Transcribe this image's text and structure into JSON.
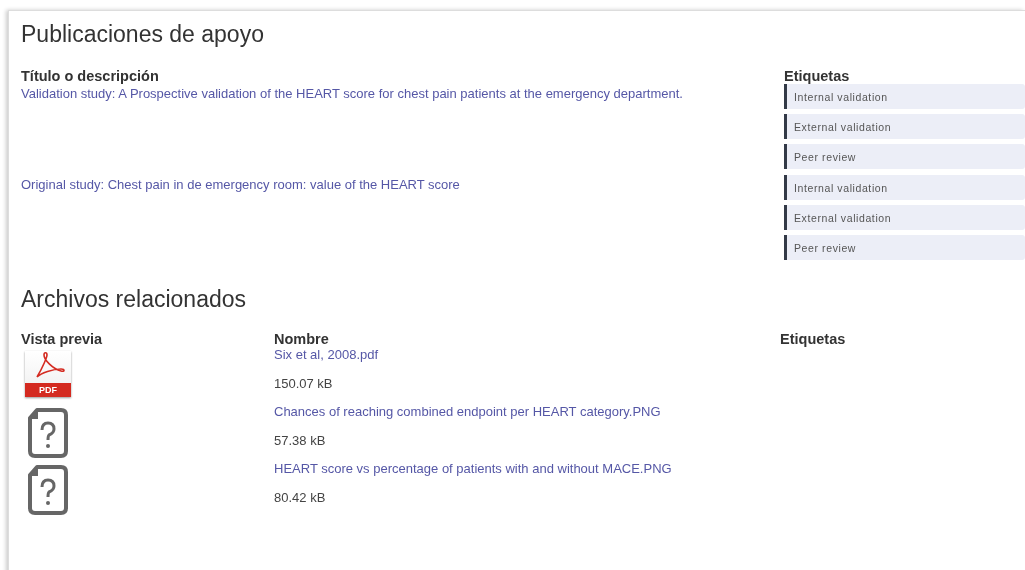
{
  "publications": {
    "title": "Publicaciones de apoyo",
    "columns": [
      "Título o descripción",
      "Etiquetas"
    ],
    "rows": [
      {
        "title": "Validation study: A Prospective validation of the HEART score for chest pain patients at the emergency department.",
        "tags": [
          "Internal validation",
          "External validation",
          "Peer review"
        ]
      },
      {
        "title": "Original study: Chest pain in de emergency room: value of the HEART score",
        "tags": [
          "Internal validation",
          "External validation",
          "Peer review"
        ]
      }
    ]
  },
  "files": {
    "title": "Archivos relacionados",
    "columns": [
      "Vista previa",
      "Nombre",
      "Etiquetas"
    ],
    "rows": [
      {
        "kind": "pdf",
        "icon_label": "PDF",
        "name": "Six et al, 2008.pdf",
        "size": "150.07 kB"
      },
      {
        "kind": "unknown",
        "name": "Chances of reaching combined endpoint per HEART category.PNG",
        "size": "57.38 kB"
      },
      {
        "kind": "unknown",
        "name": "HEART score vs percentage of patients with and without MACE.PNG",
        "size": "80.42 kB"
      }
    ]
  }
}
